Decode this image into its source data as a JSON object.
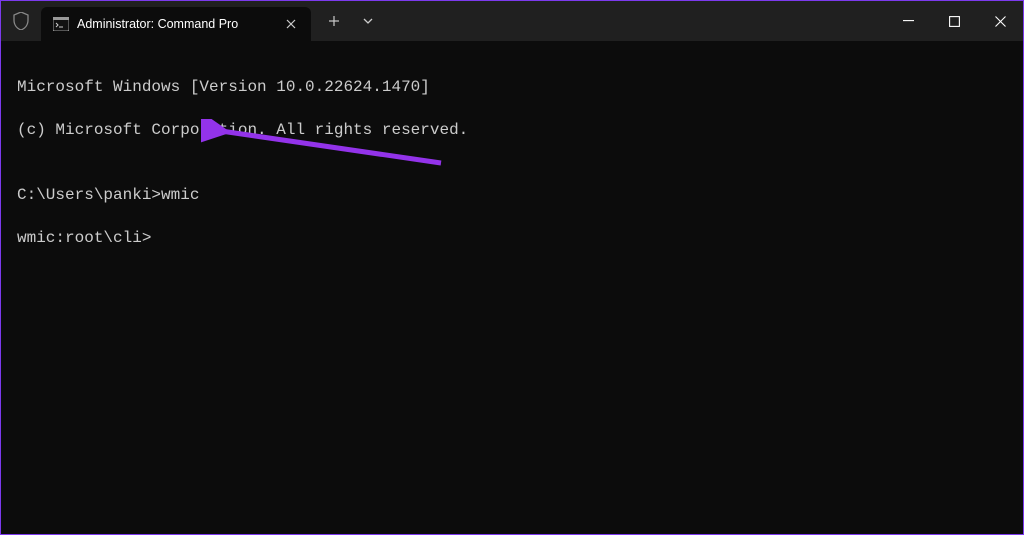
{
  "tab": {
    "title": "Administrator: Command Pro"
  },
  "terminal": {
    "line1": "Microsoft Windows [Version 10.0.22624.1470]",
    "line2": "(c) Microsoft Corporation. All rights reserved.",
    "blank": "",
    "prompt1_path": "C:\\Users\\panki>",
    "prompt1_cmd": "wmic",
    "prompt2": "wmic:root\\cli>"
  },
  "colors": {
    "accent_border": "#7c3aed",
    "arrow": "#9333ea"
  }
}
